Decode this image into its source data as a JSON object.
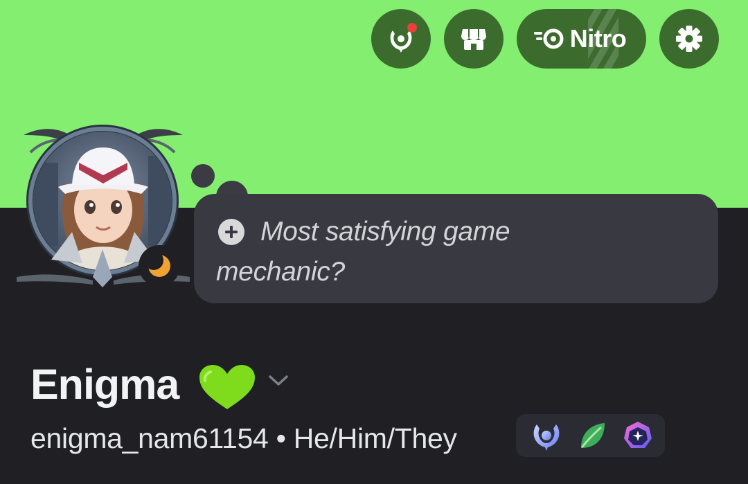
{
  "header": {
    "quests_icon": "quests-icon",
    "shop_icon": "shop-icon",
    "nitro_label": "Nitro",
    "settings_icon": "gear-icon",
    "banner_color": "#83ee6f",
    "button_color": "#3c6b2e",
    "notification_dot_color": "#e8413a"
  },
  "avatar": {
    "status": "idle",
    "status_icon": "moon-icon",
    "status_color": "#f0a232"
  },
  "status_bubble": {
    "add_icon": "plus-circle-icon",
    "text": "Most satisfying game mechanic?"
  },
  "profile": {
    "display_name": "Enigma",
    "name_emoji": "💚",
    "username_line": "enigma_nam61154 • He/Him/They",
    "badges": [
      {
        "icon": "quest-badge-icon"
      },
      {
        "icon": "leaf-badge-icon"
      },
      {
        "icon": "nitro-gem-badge-icon"
      }
    ]
  }
}
